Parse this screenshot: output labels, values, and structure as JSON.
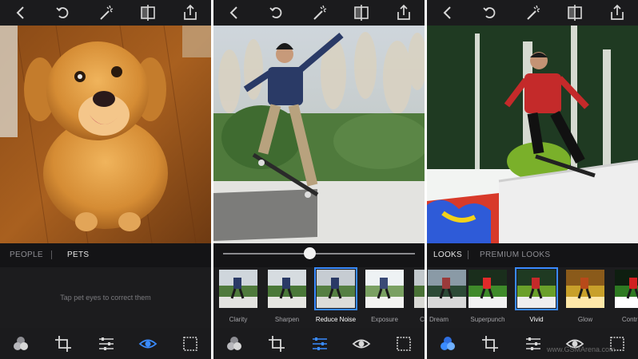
{
  "screens": [
    {
      "tabs": [
        "PEOPLE",
        "PETS"
      ],
      "active_tab": "PETS",
      "hint": "Tap pet eyes to correct them",
      "active_tool": "eye"
    },
    {
      "slider_value": 0.45,
      "adjustments": [
        "Clarity",
        "Sharpen",
        "Reduce Noise",
        "Exposure",
        "C"
      ],
      "selected_adjustment": "Reduce Noise",
      "active_tool": "adjustments"
    },
    {
      "tabs": [
        "LOOKS",
        "PREMIUM LOOKS"
      ],
      "active_tab": "LOOKS",
      "looks": [
        "Dream",
        "Superpunch",
        "Vivid",
        "Glow",
        "Contrast"
      ],
      "selected_look": "Vivid",
      "active_tool": "looks"
    }
  ],
  "toolbar_icons": [
    "back-icon",
    "undo-icon",
    "magic-wand-icon",
    "compare-icon",
    "share-icon"
  ],
  "bottom_icons": [
    "looks-icon",
    "crop-icon",
    "adjustments-icon",
    "eye-icon",
    "frame-icon"
  ],
  "colors": {
    "panel_bg": "#1c1c1e",
    "active_blue": "#3a8bff",
    "inactive_icon": "#d8d8d8"
  },
  "watermark": "www.GSMArena.com"
}
